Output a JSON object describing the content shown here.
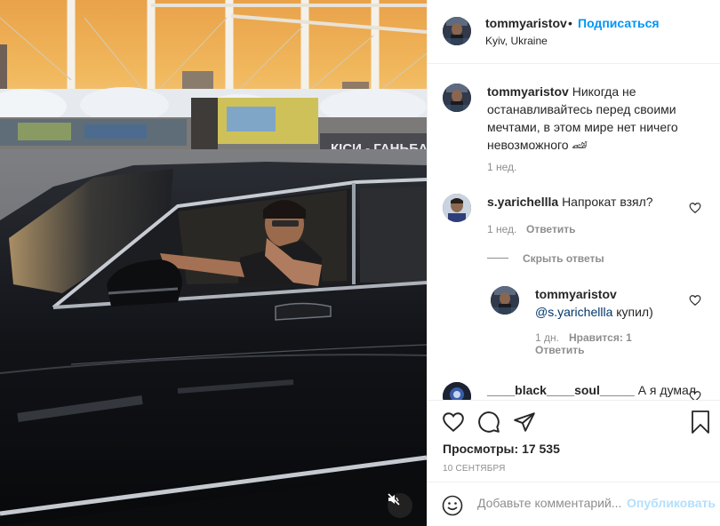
{
  "colors": {
    "accent": "#0095f6",
    "publish_disabled": "#b2dffc",
    "mention": "#00376b",
    "secondary_text": "#8e8e8e",
    "primary_text": "#262626"
  },
  "media": {
    "mute_icon": "speaker-muted-icon"
  },
  "header": {
    "username": "tommyaristov",
    "dot": "•",
    "follow_label": "Подписаться",
    "location": "Kyiv, Ukraine"
  },
  "caption": {
    "username": "tommyaristov",
    "text": "Никогда не останавливайтесь перед своими мечтами, в этом мире нет ничего невозможного 🏎",
    "time": "1 нед."
  },
  "comments": [
    {
      "username": "s.yarichellla",
      "text": "Напрокат взял?",
      "time": "1 нед.",
      "reply_label": "Ответить",
      "hide_replies_label": "Скрыть ответы",
      "replies": [
        {
          "username": "tommyaristov",
          "mention": "@s.yarichellla",
          "text": "купил)",
          "time": "1 дн.",
          "likes": "Нравится: 1",
          "reply_label": "Ответить"
        }
      ]
    },
    {
      "username": "____black____soul_____",
      "text": "А я думал"
    }
  ],
  "actions": {
    "like_icon": "heart-icon",
    "comment_icon": "comment-icon",
    "share_icon": "share-icon",
    "save_icon": "bookmark-icon",
    "views_label": "Просмотры:",
    "views_count": "17 535",
    "date": "10 СЕНТЯБРЯ"
  },
  "add_comment": {
    "placeholder": "Добавьте комментарий...",
    "publish_label": "Опубликовать"
  }
}
